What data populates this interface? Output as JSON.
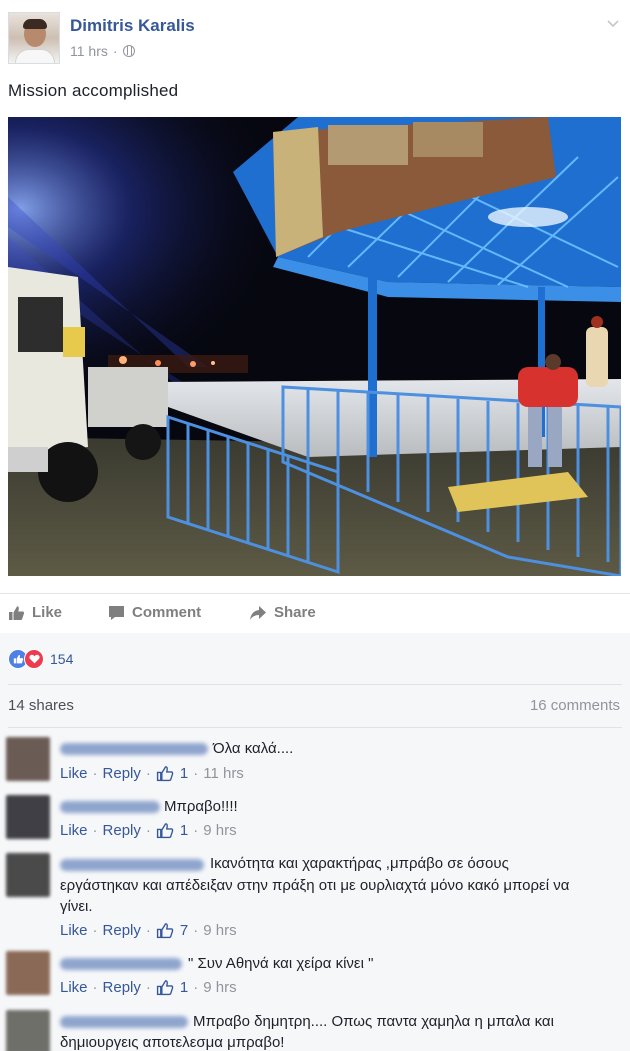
{
  "post": {
    "author": "Dimitris Karalis",
    "time": "11 hrs",
    "separator": "·",
    "text": "Mission accomplished"
  },
  "actions": {
    "like": "Like",
    "comment": "Comment",
    "share": "Share"
  },
  "reactions": {
    "count": "154",
    "types": [
      "like",
      "love"
    ]
  },
  "stats": {
    "shares": "14 shares",
    "comments": "16 comments"
  },
  "comments": [
    {
      "text": "Όλα καλά....",
      "like": "Like",
      "reply": "Reply",
      "likes": "1",
      "time": "11 hrs"
    },
    {
      "text": "Μπραβο!!!!",
      "like": "Like",
      "reply": "Reply",
      "likes": "1",
      "time": "9 hrs"
    },
    {
      "text_line1": "Ικανότητα και χαρακτήρας ,μπράβο σε όσους",
      "text_line2": "εργάστηκαν και απέδειξαν στην πράξη οτι με ουρλιαχτά μόνο κακό μπορεί να",
      "text_line3": "γίνει.",
      "like": "Like",
      "reply": "Reply",
      "likes": "7",
      "time": "9 hrs"
    },
    {
      "text": "\" Συν Αθηνά και χείρα κίνει \"",
      "like": "Like",
      "reply": "Reply",
      "likes": "1",
      "time": "9 hrs"
    },
    {
      "text_line1": "Μπραβο δημητρη.... Οπως παντα χαμηλα η μπαλα και",
      "text_line2": "δημιουργεις αποτελεσμα μπραβο!"
    }
  ],
  "colors": {
    "link_blue": "#365899",
    "muted_gray": "#90949c",
    "like_blue": "#4f80e6",
    "love_red": "#ec3c4e"
  },
  "icons": [
    "chevron-down-icon",
    "globe-icon",
    "like-icon",
    "comment-icon",
    "share-icon",
    "like-reaction-icon",
    "love-reaction-icon",
    "thumbs-up-icon"
  ]
}
